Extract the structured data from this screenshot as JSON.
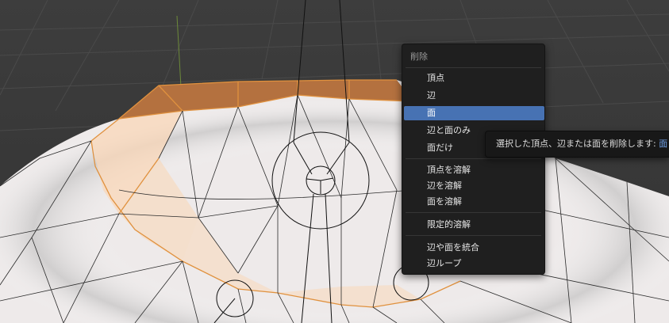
{
  "menu": {
    "title": "削除",
    "items": [
      {
        "label": "頂点"
      },
      {
        "label": "辺"
      },
      {
        "label": "面"
      },
      {
        "label": "辺と面のみ"
      },
      {
        "label": "面だけ"
      },
      {
        "label": "頂点を溶解"
      },
      {
        "label": "辺を溶解"
      },
      {
        "label": "面を溶解"
      },
      {
        "label": "限定的溶解"
      },
      {
        "label": "辺や面を統合"
      },
      {
        "label": "辺ループ"
      }
    ],
    "highlighted_item": "面"
  },
  "tooltip": {
    "description": "選択した頂点、辺または面を削除します:",
    "value": "面"
  },
  "colors": {
    "viewport_background": "#3a3a3a",
    "menu_background": "#1f1f1f",
    "highlight": "#4772b3",
    "selection_orange": "#e0913e",
    "selected_face_fill": "#f9d7b8",
    "tooltip_accent": "#6fa0e6"
  }
}
